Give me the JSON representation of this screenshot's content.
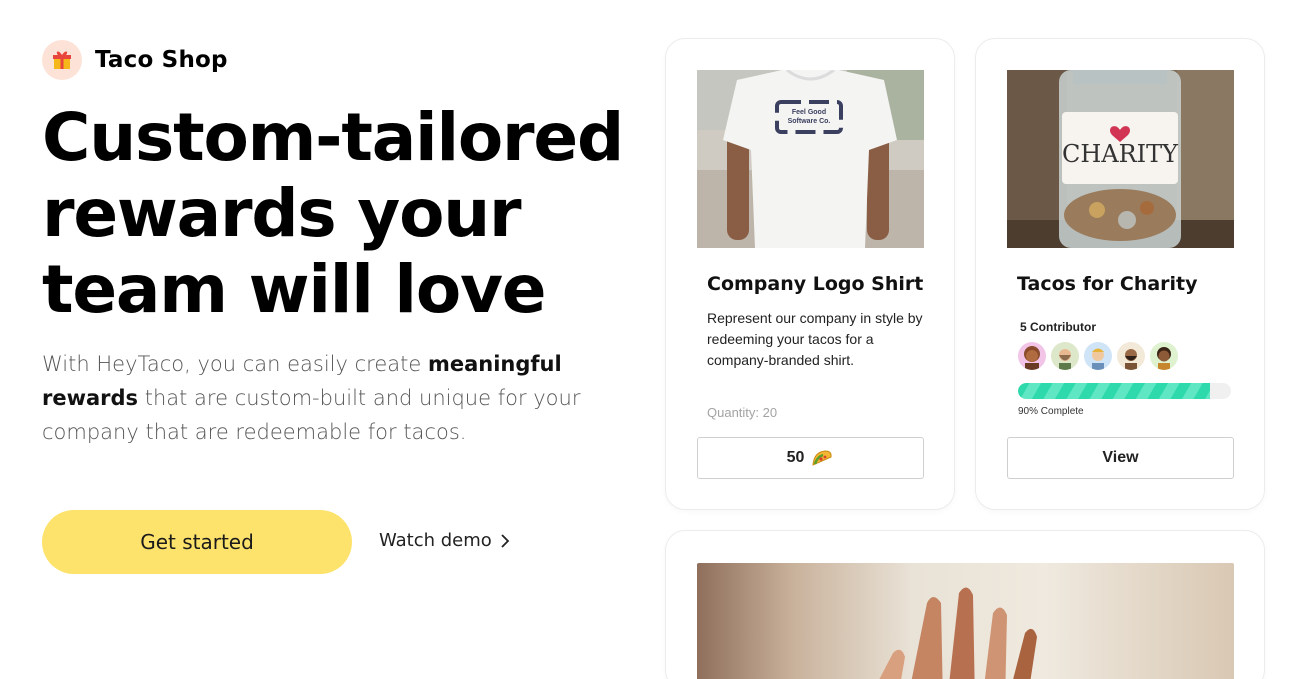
{
  "brand": {
    "name": "Taco Shop",
    "icon": "gift-icon"
  },
  "hero": {
    "headline": [
      "Custom-tailored",
      "rewards your",
      "team will love"
    ],
    "sub_before": "With HeyTaco, you can easily create ",
    "sub_bold": "meaningful rewards",
    "sub_after": " that are custom-built and unique for your company that are redeemable for tacos.",
    "cta_label": "Get started",
    "demo_label": "Watch demo"
  },
  "cards": [
    {
      "title": "Company Logo Shirt",
      "image": "tshirt-photo",
      "shirt_logo_line1": "Feel Good",
      "shirt_logo_line2": "Software Co.",
      "description": "Represent our company in style by redeeming your tacos for a company-branded shirt.",
      "quantity": "Quantity: 20",
      "button_label": "50",
      "button_icon": "taco-icon"
    },
    {
      "title": "Tacos for Charity",
      "image": "charity-jar-photo",
      "jar_label": "CHARITY",
      "contributors_label": "5 Contributor",
      "progress_percent": 90,
      "progress_label": "90% Complete",
      "button_label": "View"
    }
  ],
  "colors": {
    "cta": "#fde36c",
    "progress": "#2ed9ac",
    "brand_icon_bg": "#fde3d7"
  }
}
